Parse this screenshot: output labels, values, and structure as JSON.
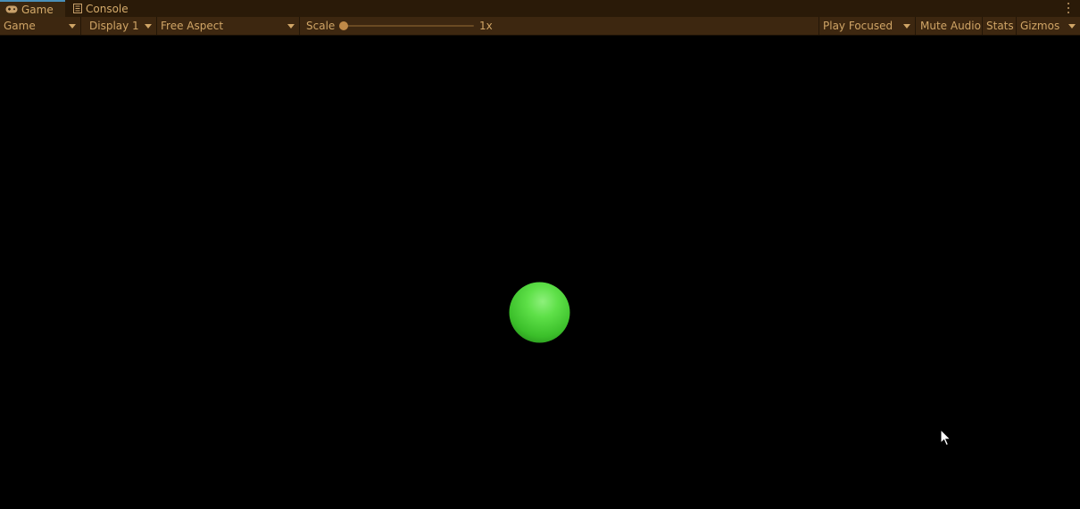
{
  "tabs": [
    {
      "label": "Game",
      "icon": "gamepad-icon",
      "active": true
    },
    {
      "label": "Console",
      "icon": "console-icon",
      "active": false
    }
  ],
  "toolbar": {
    "view_select": "Game",
    "display_select": "Display 1",
    "aspect_select": "Free Aspect",
    "scale_label": "Scale",
    "scale_value": "1x",
    "scale_fraction": 0.0,
    "play_mode_select": "Play Focused",
    "mute_audio_label": "Mute Audio",
    "stats_label": "Stats",
    "gizmos_label": "Gizmos"
  },
  "colors": {
    "accent": "#d0a566",
    "tab_bar": "#2a1a08",
    "toolbar": "#3d2710",
    "viewport": "#000000",
    "ball": "#4fd83a"
  },
  "icons": {
    "more": "kebab-menu-icon",
    "cursor": "mouse-cursor-icon"
  }
}
